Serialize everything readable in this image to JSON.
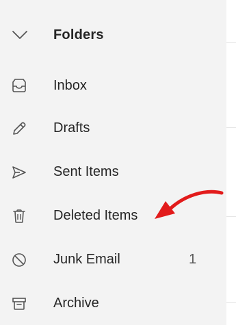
{
  "folders": {
    "title": "Folders",
    "chevron_icon": "chevron-down-icon"
  },
  "items": [
    {
      "label": "Inbox",
      "icon": "inbox-icon",
      "count": ""
    },
    {
      "label": "Drafts",
      "icon": "pencil-icon",
      "count": ""
    },
    {
      "label": "Sent Items",
      "icon": "send-icon",
      "count": ""
    },
    {
      "label": "Deleted Items",
      "icon": "trash-icon",
      "count": ""
    },
    {
      "label": "Junk Email",
      "icon": "block-icon",
      "count": "1"
    },
    {
      "label": "Archive",
      "icon": "archive-icon",
      "count": ""
    }
  ],
  "annotation": {
    "icon": "red-curved-arrow-icon",
    "color": "#e21b1b"
  },
  "colors": {
    "sidebar_bg": "#f3f3f3",
    "text": "#262626",
    "icon": "#555555"
  }
}
